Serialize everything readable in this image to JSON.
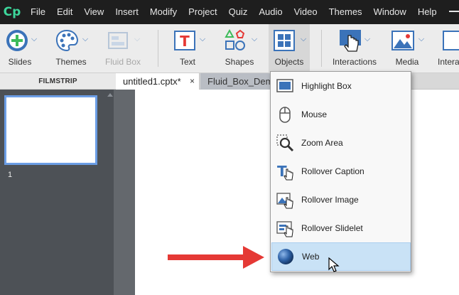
{
  "app": {
    "logo_text": "Cp"
  },
  "menu": [
    "File",
    "Edit",
    "View",
    "Insert",
    "Modify",
    "Project",
    "Quiz",
    "Audio",
    "Video",
    "Themes",
    "Window",
    "Help"
  ],
  "toolbar": {
    "slides": "Slides",
    "themes": "Themes",
    "fluid_box": "Fluid Box",
    "text": "Text",
    "shapes": "Shapes",
    "objects": "Objects",
    "interactions": "Interactions",
    "media": "Media",
    "interactions_cut": "Intera"
  },
  "filmstrip": {
    "title": "FILMSTRIP",
    "slide_number": "1"
  },
  "tabs": [
    {
      "label": "untitled1.cptx*",
      "close": "×"
    },
    {
      "label": "Fluid_Box_Dem"
    }
  ],
  "objects_menu": [
    {
      "label": "Highlight Box",
      "icon": "highlight-box-icon"
    },
    {
      "label": "Mouse",
      "icon": "mouse-icon"
    },
    {
      "label": "Zoom Area",
      "icon": "zoom-area-icon"
    },
    {
      "label": "Rollover Caption",
      "icon": "rollover-caption-icon"
    },
    {
      "label": "Rollover Image",
      "icon": "rollover-image-icon"
    },
    {
      "label": "Rollover Slidelet",
      "icon": "rollover-slidelet-icon"
    },
    {
      "label": "Web",
      "icon": "web-globe-icon",
      "selected": true
    }
  ],
  "colors": {
    "accent": "#3b73b9",
    "logo": "#3dd69b",
    "menubar": "#1e1e1e",
    "highlight": "#c9e2f6",
    "arrow": "#e53935"
  }
}
